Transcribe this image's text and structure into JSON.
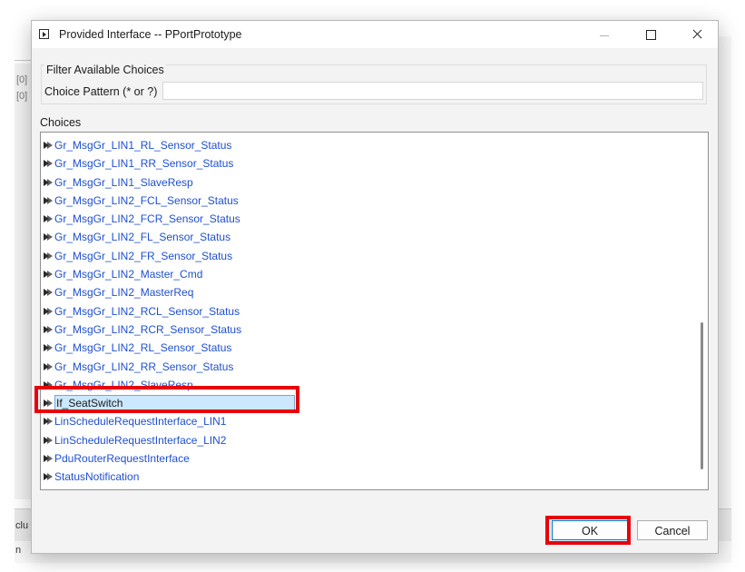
{
  "background": {
    "left_fragments": [
      "[0]",
      "[0]"
    ],
    "bottom_fragments": [
      "clu",
      "n"
    ]
  },
  "dialog": {
    "title": "Provided Interface -- PPortPrototype",
    "filter": {
      "group_label": "Filter Available Choices",
      "pattern_label": "Choice Pattern (* or ?)",
      "pattern_value": ""
    },
    "choices_label": "Choices",
    "choices": [
      {
        "label": "Gr_MsgGr_LIN1_RL_Sensor_Status",
        "selected": false
      },
      {
        "label": "Gr_MsgGr_LIN1_RR_Sensor_Status",
        "selected": false
      },
      {
        "label": "Gr_MsgGr_LIN1_SlaveResp",
        "selected": false
      },
      {
        "label": "Gr_MsgGr_LIN2_FCL_Sensor_Status",
        "selected": false
      },
      {
        "label": "Gr_MsgGr_LIN2_FCR_Sensor_Status",
        "selected": false
      },
      {
        "label": "Gr_MsgGr_LIN2_FL_Sensor_Status",
        "selected": false
      },
      {
        "label": "Gr_MsgGr_LIN2_FR_Sensor_Status",
        "selected": false
      },
      {
        "label": "Gr_MsgGr_LIN2_Master_Cmd",
        "selected": false
      },
      {
        "label": "Gr_MsgGr_LIN2_MasterReq",
        "selected": false
      },
      {
        "label": "Gr_MsgGr_LIN2_RCL_Sensor_Status",
        "selected": false
      },
      {
        "label": "Gr_MsgGr_LIN2_RCR_Sensor_Status",
        "selected": false
      },
      {
        "label": "Gr_MsgGr_LIN2_RL_Sensor_Status",
        "selected": false
      },
      {
        "label": "Gr_MsgGr_LIN2_RR_Sensor_Status",
        "selected": false
      },
      {
        "label": "Gr_MsgGr_LIN2_SlaveResp",
        "selected": false
      },
      {
        "label": "If_SeatSwitch",
        "selected": true
      },
      {
        "label": "LinScheduleRequestInterface_LIN1",
        "selected": false
      },
      {
        "label": "LinScheduleRequestInterface_LIN2",
        "selected": false
      },
      {
        "label": "PduRouterRequestInterface",
        "selected": false
      },
      {
        "label": "StatusNotification",
        "selected": false
      }
    ],
    "buttons": {
      "ok": "OK",
      "cancel": "Cancel"
    }
  },
  "colors": {
    "link_text": "#1f4fcf",
    "selection_fill": "#cce8ff",
    "annotation_red": "#e8000b"
  }
}
